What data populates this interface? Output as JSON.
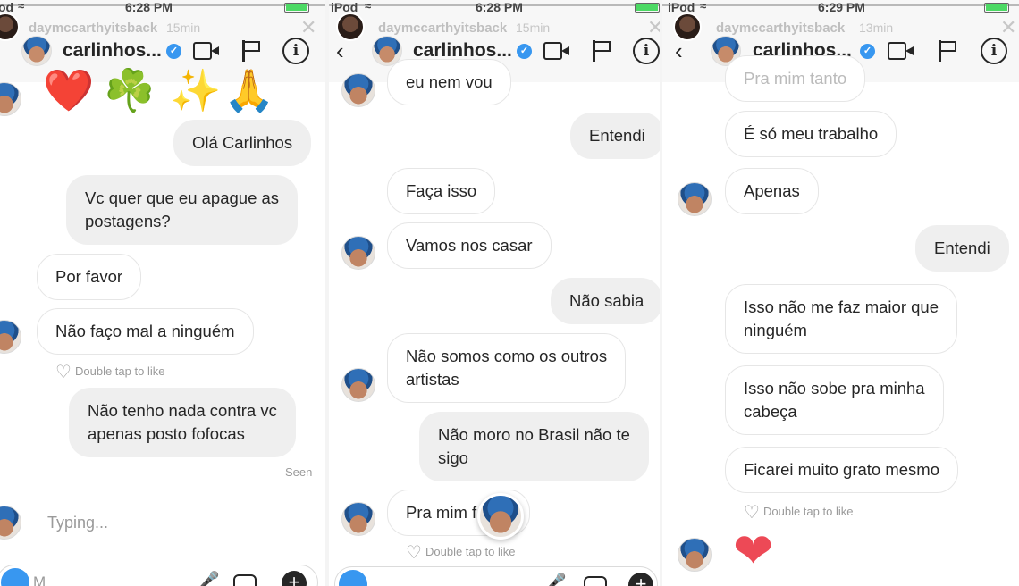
{
  "panel1": {
    "status": {
      "carrier": "od",
      "time": "6:28 PM"
    },
    "story": {
      "username": "daymccarthyitsback",
      "age": "15min"
    },
    "chat": {
      "name": "carlinhos..."
    },
    "emojis": [
      "❤️",
      "☘️",
      "✨",
      "🙏"
    ],
    "messages": [
      {
        "dir": "out",
        "lines": [
          "Olá Carlinhos"
        ]
      },
      {
        "dir": "out",
        "lines": [
          "Vc quer que eu apague as",
          "postagens?"
        ]
      },
      {
        "dir": "in",
        "lines": [
          "Por favor"
        ]
      },
      {
        "dir": "in",
        "lines": [
          "Não faço mal a ninguém"
        ]
      },
      {
        "dir": "out",
        "lines": [
          "Não tenho nada contra vc",
          "apenas posto fofocas"
        ]
      }
    ],
    "like_hint": "Double tap to like",
    "seen": "Seen",
    "typing": "Typing...",
    "composer_placeholder": "M"
  },
  "panel2": {
    "status": {
      "carrier": "iPod",
      "time": "6:28 PM"
    },
    "story": {
      "username": "daymccarthyitsback",
      "age": "15min"
    },
    "chat": {
      "name": "carlinhos..."
    },
    "messages": [
      {
        "dir": "in",
        "lines": [
          "eu nem vou"
        ]
      },
      {
        "dir": "out",
        "lines": [
          "Entendi"
        ]
      },
      {
        "dir": "in",
        "lines": [
          "Faça isso"
        ]
      },
      {
        "dir": "in",
        "lines": [
          "Vamos nos casar"
        ]
      },
      {
        "dir": "out",
        "lines": [
          "Não sabia"
        ]
      },
      {
        "dir": "in",
        "lines": [
          "Não somos como os outros",
          "artistas"
        ]
      },
      {
        "dir": "out",
        "lines": [
          "Não moro no Brasil não te",
          "sigo"
        ]
      },
      {
        "dir": "in",
        "lines": [
          "Pra mim f"
        ]
      }
    ],
    "like_hint": "Double tap to like"
  },
  "panel3": {
    "status": {
      "carrier": "iPod",
      "time": "6:29 PM"
    },
    "story": {
      "username": "daymccarthyitsback",
      "age": "13min"
    },
    "chat": {
      "name": "carlinhos..."
    },
    "messages": [
      {
        "dir": "in",
        "lines": [
          "Pra mim tanto"
        ]
      },
      {
        "dir": "in",
        "lines": [
          "É só meu trabalho"
        ]
      },
      {
        "dir": "in",
        "lines": [
          "Apenas"
        ]
      },
      {
        "dir": "out",
        "lines": [
          "Entendi"
        ]
      },
      {
        "dir": "in",
        "lines": [
          "Isso não me faz maior que",
          "ninguém"
        ]
      },
      {
        "dir": "in",
        "lines": [
          "Isso não sobe pra minha",
          "cabeça"
        ]
      },
      {
        "dir": "in",
        "lines": [
          "Ficarei muito grato mesmo"
        ]
      }
    ],
    "like_hint": "Double tap to like",
    "reaction": "❤"
  },
  "colors": {
    "accent": "#3897f0",
    "heart": "#ed4956",
    "battery": "#4cd964",
    "bubble_out": "#efefef",
    "text": "#262626",
    "muted": "#9a9a9a"
  },
  "icons": {
    "verified": "verified-badge-icon",
    "video": "video-call-icon",
    "flag": "flag-icon",
    "info": "info-icon",
    "back": "chevron-left-icon",
    "close": "close-icon",
    "heart": "heart-outline-icon"
  }
}
